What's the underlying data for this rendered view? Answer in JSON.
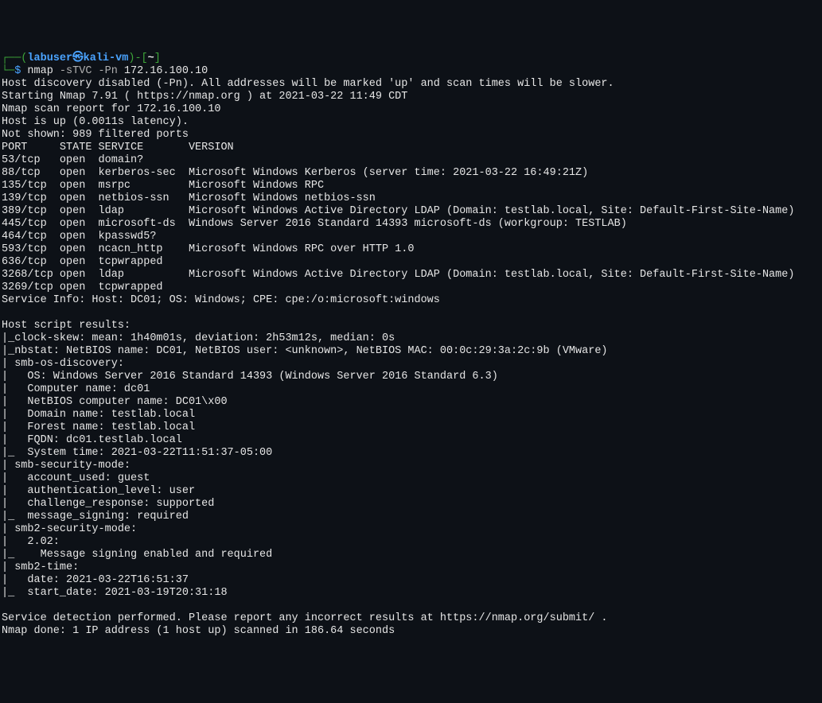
{
  "prompt": {
    "l_paren": "┌──(",
    "username": "labuser",
    "at": "㉿",
    "hostname": "kali-vm",
    "r_paren": ")-[",
    "cwd": "~",
    "r_brack": "]",
    "line2_prefix": "└─",
    "dollar": "$ ",
    "cmd": "nmap",
    "opt1": " -sTVC",
    "opt2": " -Pn",
    "arg": " 172.16.100.10"
  },
  "out": {
    "l1": "Host discovery disabled (-Pn). All addresses will be marked 'up' and scan times will be slower.",
    "l2": "Starting Nmap 7.91 ( https://nmap.org ) at 2021-03-22 11:49 CDT",
    "l3": "Nmap scan report for 172.16.100.10",
    "l4": "Host is up (0.0011s latency).",
    "l5": "Not shown: 989 filtered ports",
    "l6": "PORT     STATE SERVICE       VERSION",
    "l7": "53/tcp   open  domain?",
    "l8": "88/tcp   open  kerberos-sec  Microsoft Windows Kerberos (server time: 2021-03-22 16:49:21Z)",
    "l9": "135/tcp  open  msrpc         Microsoft Windows RPC",
    "l10": "139/tcp  open  netbios-ssn   Microsoft Windows netbios-ssn",
    "l11": "389/tcp  open  ldap          Microsoft Windows Active Directory LDAP (Domain: testlab.local, Site: Default-First-Site-Name)",
    "l12": "445/tcp  open  microsoft-ds  Windows Server 2016 Standard 14393 microsoft-ds (workgroup: TESTLAB)",
    "l13": "464/tcp  open  kpasswd5?",
    "l14": "593/tcp  open  ncacn_http    Microsoft Windows RPC over HTTP 1.0",
    "l15": "636/tcp  open  tcpwrapped",
    "l16": "3268/tcp open  ldap          Microsoft Windows Active Directory LDAP (Domain: testlab.local, Site: Default-First-Site-Name)",
    "l17": "3269/tcp open  tcpwrapped",
    "l18": "Service Info: Host: DC01; OS: Windows; CPE: cpe:/o:microsoft:windows",
    "l19": "",
    "l20": "Host script results:",
    "l21": "|_clock-skew: mean: 1h40m01s, deviation: 2h53m12s, median: 0s",
    "l22": "|_nbstat: NetBIOS name: DC01, NetBIOS user: <unknown>, NetBIOS MAC: 00:0c:29:3a:2c:9b (VMware)",
    "l23": "| smb-os-discovery:",
    "l24": "|   OS: Windows Server 2016 Standard 14393 (Windows Server 2016 Standard 6.3)",
    "l25": "|   Computer name: dc01",
    "l26": "|   NetBIOS computer name: DC01\\x00",
    "l27": "|   Domain name: testlab.local",
    "l28": "|   Forest name: testlab.local",
    "l29": "|   FQDN: dc01.testlab.local",
    "l30": "|_  System time: 2021-03-22T11:51:37-05:00",
    "l31": "| smb-security-mode:",
    "l32": "|   account_used: guest",
    "l33": "|   authentication_level: user",
    "l34": "|   challenge_response: supported",
    "l35": "|_  message_signing: required",
    "l36": "| smb2-security-mode:",
    "l37": "|   2.02:",
    "l38": "|_    Message signing enabled and required",
    "l39": "| smb2-time:",
    "l40": "|   date: 2021-03-22T16:51:37",
    "l41": "|_  start_date: 2021-03-19T20:31:18",
    "l42": "",
    "l43": "Service detection performed. Please report any incorrect results at https://nmap.org/submit/ .",
    "l44": "Nmap done: 1 IP address (1 host up) scanned in 186.64 seconds"
  }
}
